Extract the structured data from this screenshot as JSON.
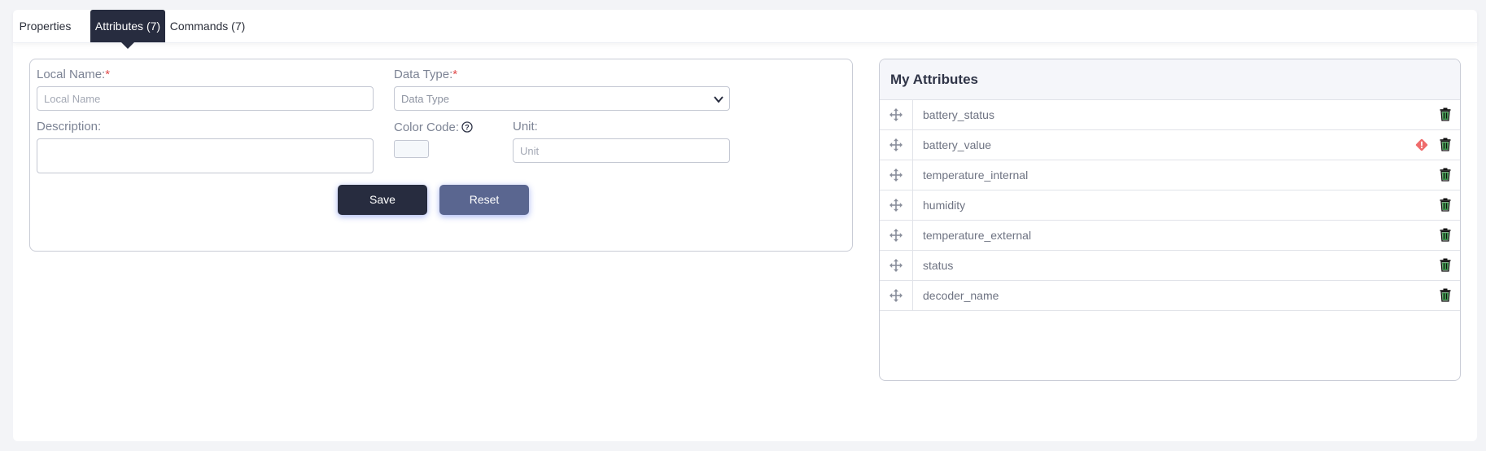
{
  "tabs": [
    {
      "label": "Properties",
      "active": false
    },
    {
      "label": "Attributes (7)",
      "active": true
    },
    {
      "label": "Commands (7)",
      "active": false
    }
  ],
  "form": {
    "local_name_label": "Local Name:",
    "local_name_placeholder": "Local Name",
    "local_name_value": "",
    "data_type_label": "Data Type:",
    "data_type_placeholder": "Data Type",
    "description_label": "Description:",
    "description_value": "",
    "color_code_label": "Color Code:",
    "unit_label": "Unit:",
    "unit_placeholder": "Unit",
    "unit_value": "",
    "required_mark": "*",
    "save_label": "Save",
    "reset_label": "Reset"
  },
  "attributes_panel": {
    "title": "My Attributes",
    "items": [
      {
        "name": "battery_status",
        "warning": false
      },
      {
        "name": "battery_value",
        "warning": true
      },
      {
        "name": "temperature_internal",
        "warning": false
      },
      {
        "name": "humidity",
        "warning": false
      },
      {
        "name": "temperature_external",
        "warning": false
      },
      {
        "name": "status",
        "warning": false
      },
      {
        "name": "decoder_name",
        "warning": false
      }
    ]
  },
  "colors": {
    "accent_dark": "#272c3f",
    "reset_button": "#5a6690",
    "required": "#e04b4b",
    "warning": "#ef6b6b",
    "trash": "#1e7d3a"
  }
}
